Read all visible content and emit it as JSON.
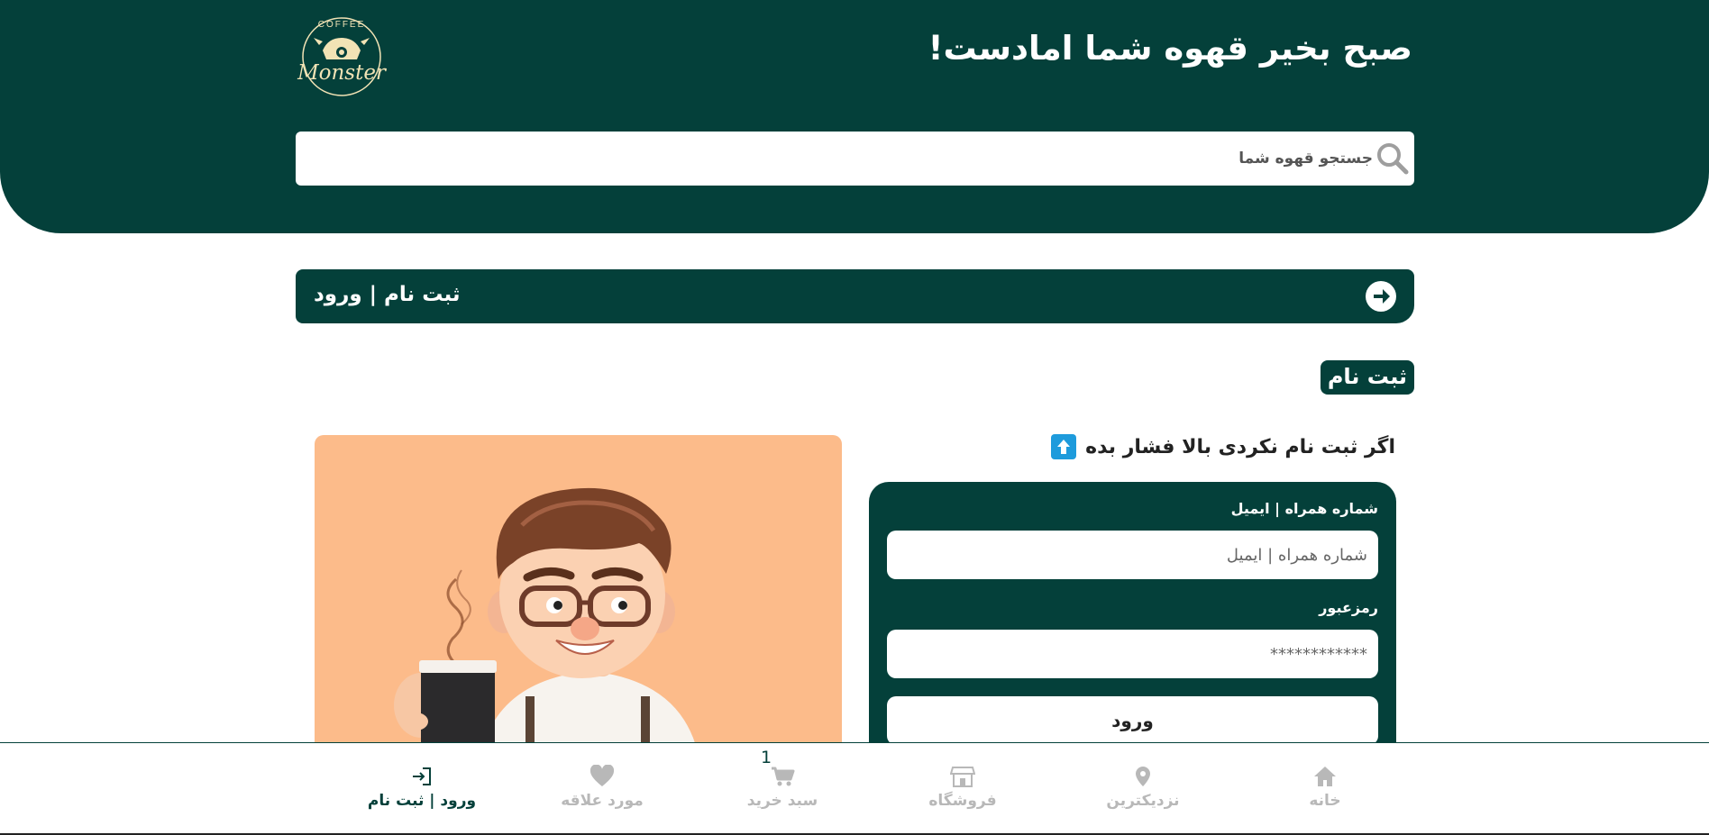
{
  "header": {
    "greeting": "صبح بخیر قهوه شما امادست!",
    "logo_top": "COFFEE",
    "logo_bottom": "Monster"
  },
  "search": {
    "placeholder": "جستجو قهوه شما",
    "icon": "search-icon"
  },
  "auth_bar": {
    "title": "ثبت نام | ورود",
    "icon": "arrow-right-circle-icon"
  },
  "section": {
    "badge": "ثبت نام",
    "hint": "اگر ثبت نام نکردی بالا فشار بده",
    "hint_icon": "arrow-up-icon"
  },
  "login_form": {
    "username_label": "شماره همراه | ایمیل",
    "username_placeholder": "شماره همراه | ایمیل",
    "password_label": "رمزعبور",
    "password_value": "************",
    "submit_label": "ورود"
  },
  "bottom_nav": {
    "items": [
      {
        "label": "خانه",
        "icon": "home-icon",
        "active": false
      },
      {
        "label": "نزدیکترین",
        "icon": "map-pin-icon",
        "active": false
      },
      {
        "label": "فروشگاه",
        "icon": "store-icon",
        "active": false
      },
      {
        "label": "سبد خرید",
        "icon": "cart-icon",
        "active": false
      },
      {
        "label": "مورد علاقه",
        "icon": "heart-icon",
        "active": false
      },
      {
        "label": "ورود | ثبت نام",
        "icon": "login-icon",
        "active": true
      }
    ],
    "cart_count": "1"
  },
  "colors": {
    "primary": "#04403a",
    "illustration_bg": "#fcbb8a",
    "hint_icon_bg": "#1e9bdc",
    "nav_inactive": "#b8b8b8"
  }
}
